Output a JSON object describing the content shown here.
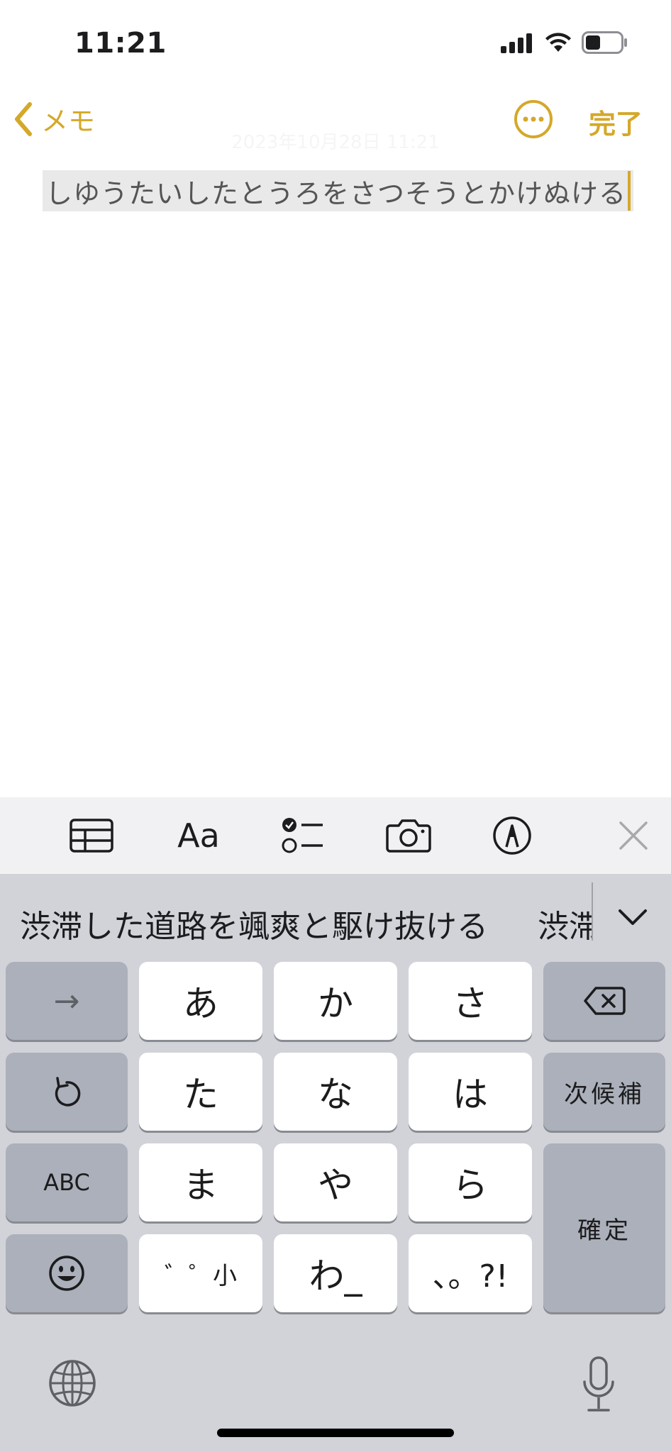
{
  "status_bar": {
    "time": "11:21"
  },
  "nav": {
    "back_label": "メモ",
    "done_label": "完了"
  },
  "note": {
    "date_faint": "2023年10月28日 11:21",
    "body_text": "しゆうたいしたとうろをさつそうとかけぬける"
  },
  "toolbar": {
    "icons": [
      "table-icon",
      "text-format-icon",
      "checklist-icon",
      "camera-icon",
      "markup-pen-icon",
      "close-icon"
    ],
    "format_label": "Aa"
  },
  "keyboard": {
    "candidates": {
      "primary": "渋滞した道路を颯爽と駆け抜ける",
      "secondary": "渋滞"
    },
    "keys": {
      "arrow": "→",
      "a": "あ",
      "ka": "か",
      "sa": "さ",
      "ta": "た",
      "na": "な",
      "ha": "は",
      "next_candidate": "次候補",
      "abc": "ABC",
      "ma": "ま",
      "ya": "や",
      "ra": "ら",
      "confirm": "確定",
      "dakuten": "゛゜小",
      "wa": "わ_",
      "punct": "、。?!"
    }
  },
  "colors": {
    "accent": "#d4a82a",
    "keyboard_bg": "#d1d3d9",
    "key_dark": "#abb0ba",
    "toolbar_bg": "#f1f1f3"
  }
}
